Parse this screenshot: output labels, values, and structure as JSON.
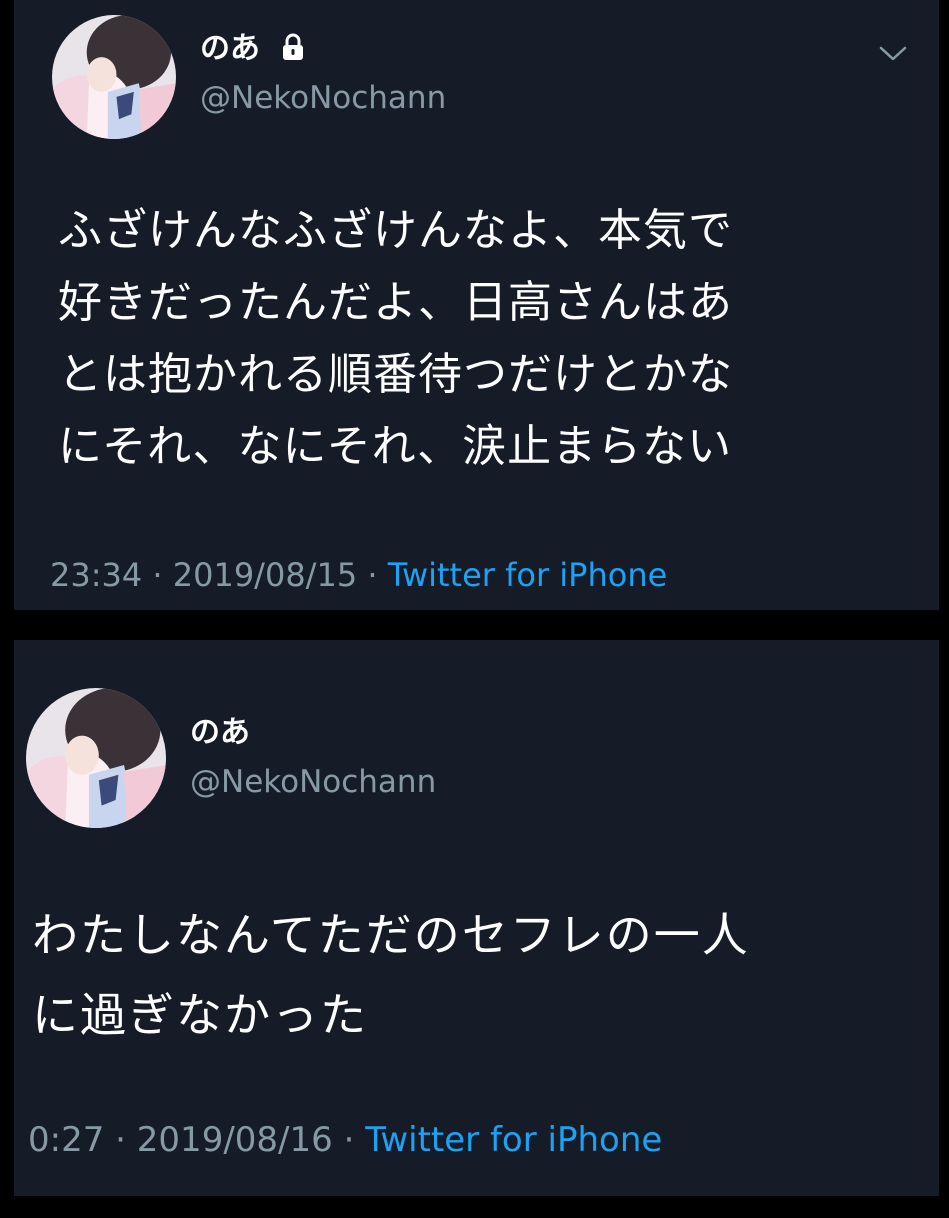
{
  "tweets": [
    {
      "display_name": "のあ",
      "protected": true,
      "handle": "@NekoNochann",
      "text_lines": [
        "ふざけんなふざけんなよ、本気で",
        "好きだったんだよ、日高さんはあ",
        "とは抱かれる順番待つだけとかな",
        "にそれ、なにそれ、涙止まらない"
      ],
      "time": "23:34",
      "date": "2019/08/15",
      "source": "Twitter for iPhone",
      "separator": "·"
    },
    {
      "display_name": "のあ",
      "protected": false,
      "handle": "@NekoNochann",
      "text_lines": [
        "わたしなんてただのセフレの一人",
        "に過ぎなかった"
      ],
      "time": "0:27",
      "date": "2019/08/16",
      "source": "Twitter for iPhone",
      "separator": "·"
    }
  ],
  "icons": {
    "lock": "lock-icon",
    "chevron": "chevron-down-icon",
    "avatar": "avatar"
  },
  "colors": {
    "card_background": "#151c28",
    "page_background": "#000000",
    "text_primary": "#ffffff",
    "text_secondary": "#8899a6",
    "link": "#1da1f2"
  }
}
